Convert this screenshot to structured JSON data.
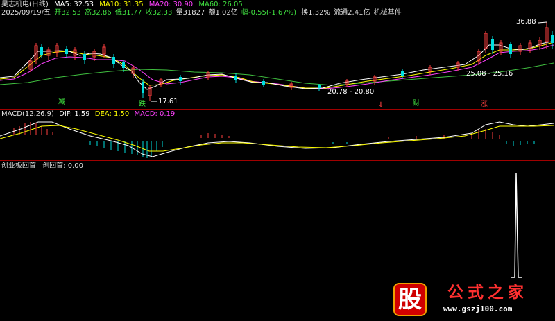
{
  "header": {
    "stock_name": "昊志机电(日线)",
    "ma5": "MA5: 32.53",
    "ma10": "MA10: 31.35",
    "ma20": "MA20: 30.90",
    "ma60": "MA60: 26.05",
    "date": "2025/09/19/五",
    "open": "开32.53",
    "high": "高32.86",
    "low": "低31.77",
    "close": "收32.33",
    "volume": "量31827",
    "amount": "额1.02亿",
    "change": "幅-0.55(-1.67%)",
    "turnover": "换1.32%",
    "float": "流通2.41亿",
    "sector": "机械基件"
  },
  "price_panel": {
    "high_label": "36.88",
    "low_label": "17.61",
    "range_label_1": "20.78 - 20.80",
    "range_label_2": "25.08 - 25.16",
    "signal_1": "减",
    "signal_2": "跌",
    "signal_3": "⇓",
    "signal_4": "财",
    "signal_5": "涨"
  },
  "macd_panel": {
    "title": "MACD(12,26,9)",
    "dif": "DIF: 1.59",
    "dea": "DEA: 1.50",
    "macd": "MACD: 0.19"
  },
  "indicator_panel": {
    "title": "创业板回首",
    "value": "创回首: 0.00"
  },
  "watermark": {
    "logo_char": "股",
    "text": "公式之家",
    "url": "www.gszj100.com"
  },
  "colors": {
    "up": "#ff4040",
    "down": "#00e0e0",
    "ma5": "#ffffff",
    "ma10": "#ffff00",
    "ma20": "#ff40ff",
    "ma60": "#40c040",
    "panel_border": "#a00000",
    "signal_green": "#40e040",
    "signal_red": "#ff4040"
  }
}
